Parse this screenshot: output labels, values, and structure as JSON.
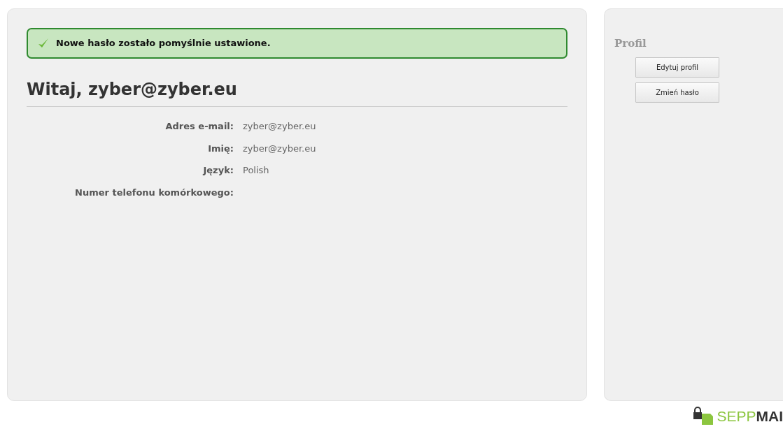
{
  "alert": {
    "kind": "success",
    "message": "Nowe hasło zostało pomyślnie ustawione."
  },
  "heading": "Witaj, zyber@zyber.eu",
  "details": [
    {
      "label": "Adres e-mail:",
      "value": "zyber@zyber.eu"
    },
    {
      "label": "Imię:",
      "value": "zyber@zyber.eu"
    },
    {
      "label": "Język:",
      "value": "Polish"
    },
    {
      "label": "Numer telefonu komórkowego:"
    }
  ],
  "sidebar": {
    "title": "Profil",
    "buttons": [
      "Edytuj profil",
      "Zmień hasło"
    ]
  },
  "logo": {
    "part_1": "SEPP",
    "part_2": "MAI"
  }
}
